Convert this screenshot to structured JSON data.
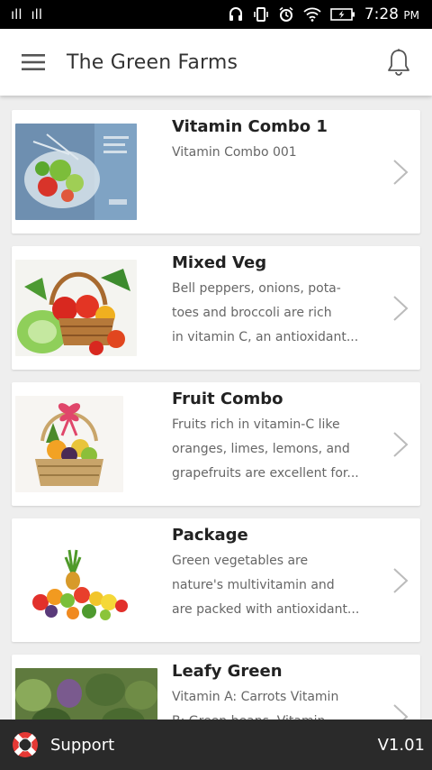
{
  "status_bar": {
    "signal_1": "ıll",
    "signal_2": "ıll",
    "time": "7:28",
    "meridiem": "PM",
    "icons": [
      "headset-icon",
      "vibrate-icon",
      "alarm-icon",
      "wifi-icon",
      "battery-charging-icon"
    ]
  },
  "header": {
    "title": "The Green Farms",
    "menu_icon": "hamburger-menu-icon",
    "notification_icon": "bell-icon"
  },
  "products": [
    {
      "title": "Vitamin Combo 1",
      "description": [
        "Vitamin Combo 001"
      ],
      "image": "salad-vegetables-photo"
    },
    {
      "title": "Mixed Veg",
      "description": [
        "Bell peppers, onions, pota-",
        "toes and broccoli are rich",
        "in vitamin C, an antioxidant..."
      ],
      "image": "vegetable-basket-photo"
    },
    {
      "title": "Fruit Combo",
      "description": [
        "Fruits rich in vitamin-C like",
        "oranges, limes, lemons, and",
        "grapefruits are excellent for..."
      ],
      "image": "fruit-basket-photo"
    },
    {
      "title": "Package",
      "description": [
        "Green vegetables are",
        "nature's multivitamin and",
        "are packed with antioxidant..."
      ],
      "image": "fruit-assortment-photo"
    },
    {
      "title": "Leafy Green",
      "description": [
        "Vitamin A: Carrots Vitamin",
        "B: Green beans, Vitamin"
      ],
      "image": "leafy-greens-photo"
    }
  ],
  "footer": {
    "support_label": "Support",
    "support_icon": "lifebuoy-icon",
    "version": "V1.01"
  },
  "colors": {
    "status_bar": "#000000",
    "header": "#ffffff",
    "background": "#eeeeee",
    "footer": "#2a2a2a",
    "lifebuoy": "#e53935"
  }
}
